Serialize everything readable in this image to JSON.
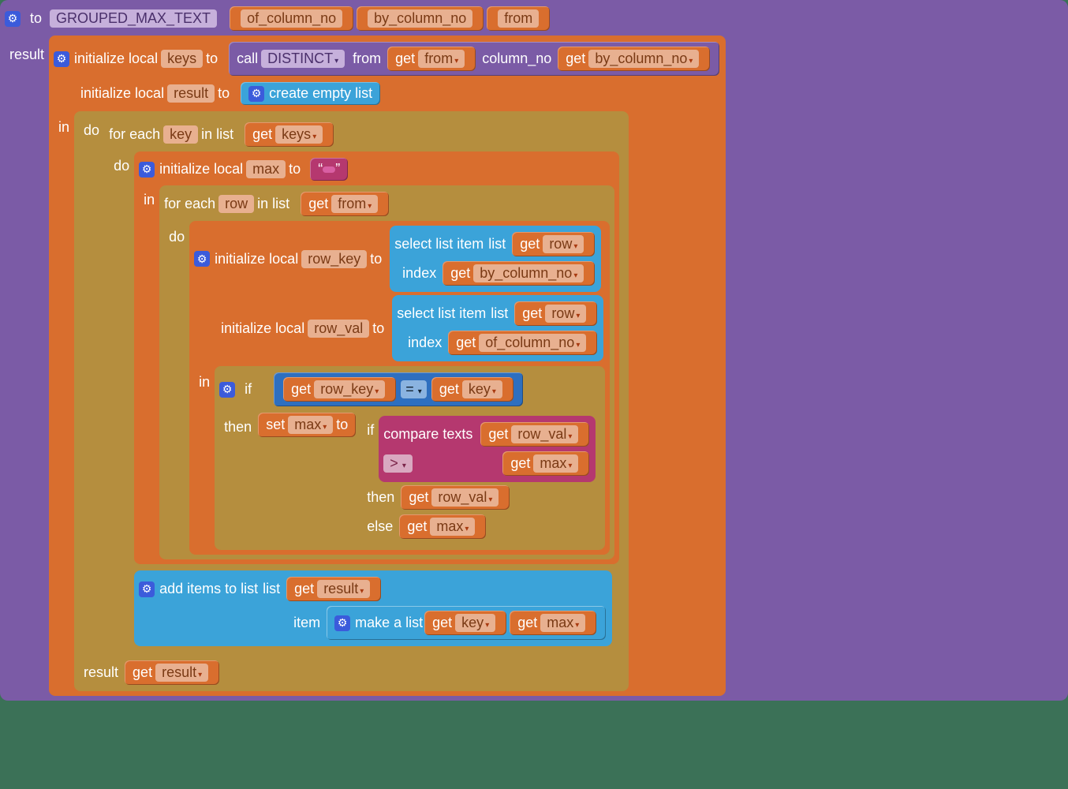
{
  "procedure": {
    "to": "to",
    "name": "GROUPED_MAX_TEXT",
    "params": [
      "of_column_no",
      "by_column_no",
      "from"
    ],
    "result_label": "result"
  },
  "labels": {
    "initialize_local": "initialize local",
    "to": "to",
    "in": "in",
    "do": "do",
    "result": "result",
    "for_each": "for each",
    "in_list": "in list",
    "if": "if",
    "then": "then",
    "else": "else",
    "set": "set",
    "call": "call",
    "from": "from",
    "column_no": "column_no",
    "get": "get",
    "compare_texts": "compare texts",
    "add_items_to_list": "add items to list",
    "list": "list",
    "item": "item",
    "make_a_list": "make a list",
    "create_empty_list": "create empty list",
    "select_list_item": "select list item",
    "index": "index",
    "distinct": "DISTINCT"
  },
  "vars": {
    "keys": "keys",
    "result": "result",
    "key": "key",
    "max": "max",
    "row": "row",
    "row_key": "row_key",
    "row_val": "row_val",
    "from": "from",
    "by_column_no": "by_column_no",
    "of_column_no": "of_column_no"
  },
  "ops": {
    "eq": "=",
    "gt": ">"
  },
  "literals": {
    "empty_string": " "
  }
}
